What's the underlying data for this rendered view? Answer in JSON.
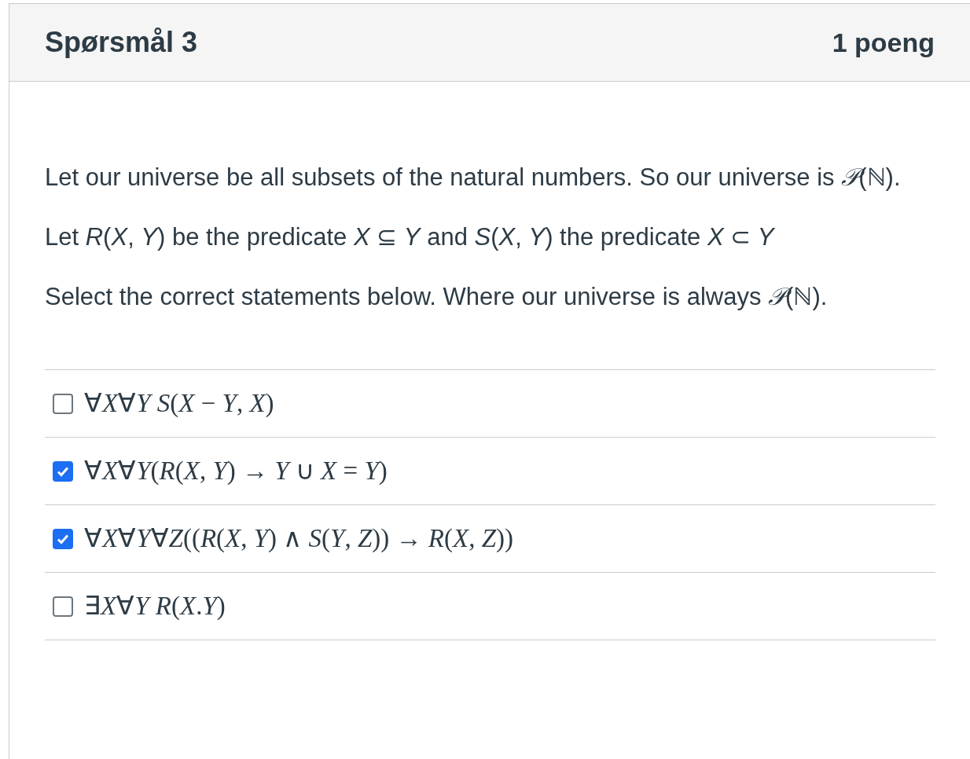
{
  "header": {
    "title": "Spørsmål 3",
    "points": "1 poeng"
  },
  "paragraphs": [
    "Let our universe be all subsets of the natural numbers. So our universe is *𝒫*(ℕ).",
    "Let *R*(*X*, *Y*) be the predicate *X* ⊆ *Y* and *S*(*X*, *Y*) the predicate *X* ⊂ *Y*",
    "Select the correct statements below. Where our universe is always *𝒫*(ℕ)."
  ],
  "answers": [
    {
      "text": "∀*X*∀*Y* *S*(*X* − *Y*, *X*)",
      "checked": false
    },
    {
      "text": "∀*X*∀*Y*(*R*(*X*, *Y*) → *Y* ∪ *X* = *Y*)",
      "checked": true
    },
    {
      "text": "∀*X*∀*Y*∀*Z*((*R*(*X*, *Y*) ∧ *S*(*Y*, *Z*)) → *R*(*X*, *Z*))",
      "checked": true
    },
    {
      "text": "∃*X*∀*Y* *R*(*X*.*Y*)",
      "checked": false
    }
  ]
}
